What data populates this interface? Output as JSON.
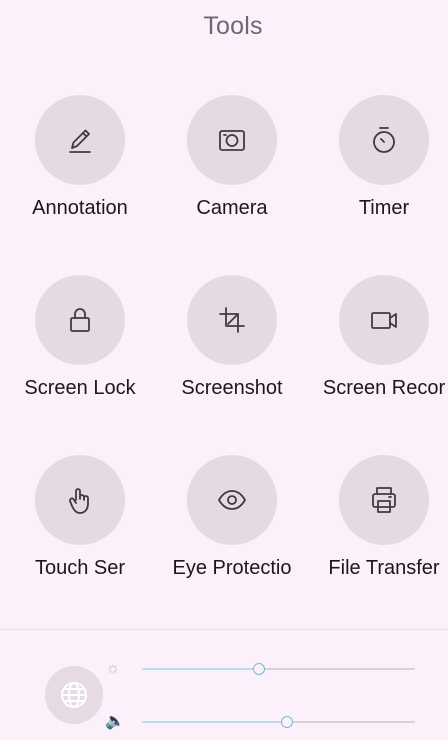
{
  "panel": {
    "title": "Tools"
  },
  "tools": [
    {
      "label": "Annotation",
      "icon": "pencil-icon"
    },
    {
      "label": "Camera",
      "icon": "camera-icon"
    },
    {
      "label": "Timer",
      "icon": "stopwatch-icon"
    },
    {
      "label": "Screen Lock",
      "icon": "lock-icon"
    },
    {
      "label": "Screenshot",
      "icon": "crop-icon"
    },
    {
      "label": "Screen Recor",
      "icon": "video-camera-icon"
    },
    {
      "label": "Touch Ser",
      "icon": "touch-hand-icon"
    },
    {
      "label": "Eye Protectio",
      "icon": "eye-icon"
    },
    {
      "label": "File Transfer",
      "icon": "printer-icon"
    }
  ],
  "controls": {
    "brightness": {
      "icon": "sun-icon",
      "level": 0.43
    },
    "volume": {
      "icon": "speaker-icon",
      "level": 0.53
    },
    "bottom_icon": "globe-icon"
  },
  "colors": {
    "background": "#fcf1fb",
    "circle": "#e5dae3",
    "icon_stroke": "#3f3a42",
    "slider_fill": "#b9ddeb",
    "slider_thumb_border": "#73bad7"
  }
}
